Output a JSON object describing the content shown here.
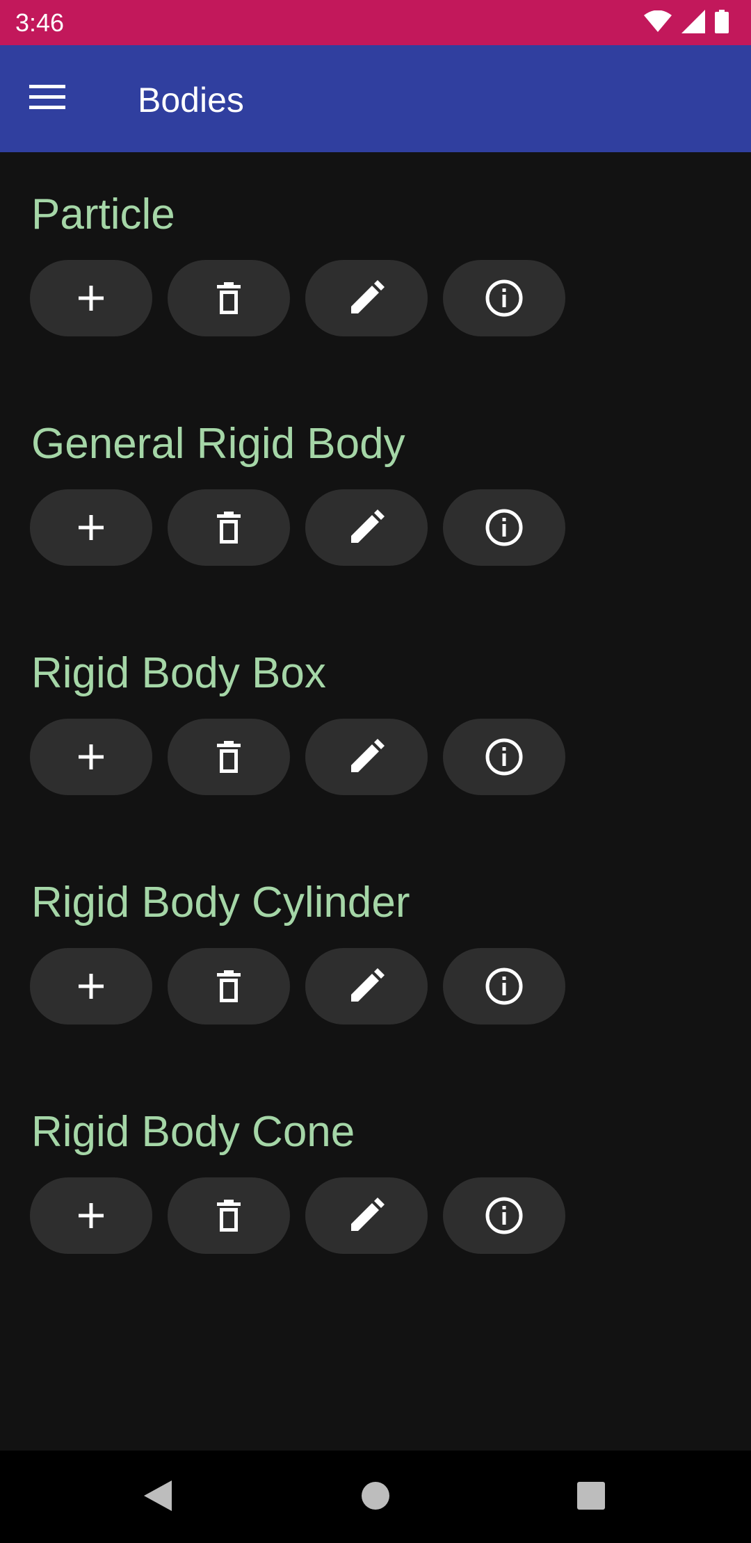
{
  "status_bar": {
    "time": "3:46",
    "icons": [
      "wifi-icon",
      "cell-signal-icon",
      "battery-icon"
    ]
  },
  "app_bar": {
    "title": "Bodies",
    "menu_icon": "menu-icon"
  },
  "sections": [
    {
      "title": "Particle"
    },
    {
      "title": "General Rigid Body"
    },
    {
      "title": "Rigid Body Box"
    },
    {
      "title": "Rigid Body Cylinder"
    },
    {
      "title": "Rigid Body Cone"
    }
  ],
  "actions": [
    "plus-icon",
    "trash-icon",
    "pencil-icon",
    "info-icon"
  ],
  "nav_bar": {
    "icons": [
      "back-icon",
      "home-icon",
      "recents-icon"
    ]
  },
  "colors": {
    "status_bar": "#C2185B",
    "app_bar": "#303F9F",
    "background": "#121212",
    "section_title": "#A5D6A7",
    "button_bg": "#2E2E2E"
  }
}
